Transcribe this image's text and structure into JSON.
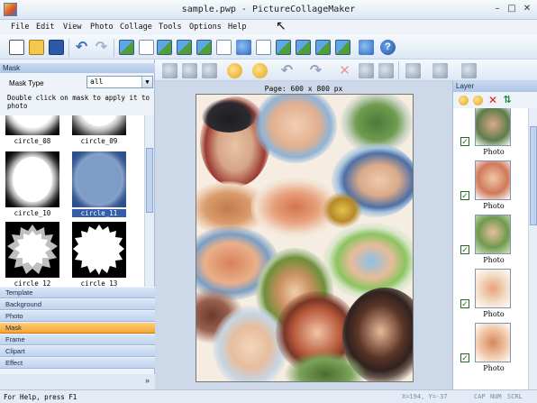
{
  "window": {
    "title": "sample.pwp - PictureCollageMaker"
  },
  "menu": [
    "File",
    "Edit",
    "View",
    "Photo",
    "Collage",
    "Tools",
    "Options",
    "Help"
  ],
  "left_panel": {
    "header": "Mask",
    "mask_type_label": "Mask Type",
    "mask_type_value": "all",
    "hint": "Double click on mask to apply it to photo",
    "masks": [
      {
        "label": "circle_08",
        "selected": false
      },
      {
        "label": "circle_09",
        "selected": false
      },
      {
        "label": "circle_10",
        "selected": false
      },
      {
        "label": "circle_11",
        "selected": true
      },
      {
        "label": "circle_12",
        "selected": false
      },
      {
        "label": "circle_13",
        "selected": false
      }
    ],
    "splitter": "::::::::",
    "categories": [
      {
        "label": "Template",
        "active": false
      },
      {
        "label": "Background",
        "active": false
      },
      {
        "label": "Photo",
        "active": false
      },
      {
        "label": "Mask",
        "active": true
      },
      {
        "label": "Frame",
        "active": false
      },
      {
        "label": "Clipart",
        "active": false
      },
      {
        "label": "Effect",
        "active": false
      }
    ],
    "more": "»"
  },
  "canvas": {
    "page_label": "Page: 600 x 800 px"
  },
  "layer_panel": {
    "header": "Layer",
    "items": [
      {
        "name": "Photo",
        "checked": true
      },
      {
        "name": "Photo",
        "checked": true
      },
      {
        "name": "Photo",
        "checked": true
      },
      {
        "name": "Photo",
        "checked": true
      },
      {
        "name": "Photo",
        "checked": true
      }
    ]
  },
  "status": {
    "help": "For Help, press F1",
    "coords": "X=194, Y=-37",
    "indicators": [
      "CAP",
      "NUM",
      "SCRL"
    ]
  },
  "colors": {
    "selected_category": "#f5a533",
    "selection_blue": "#335ea8",
    "check_green": "#1d7a1d"
  }
}
